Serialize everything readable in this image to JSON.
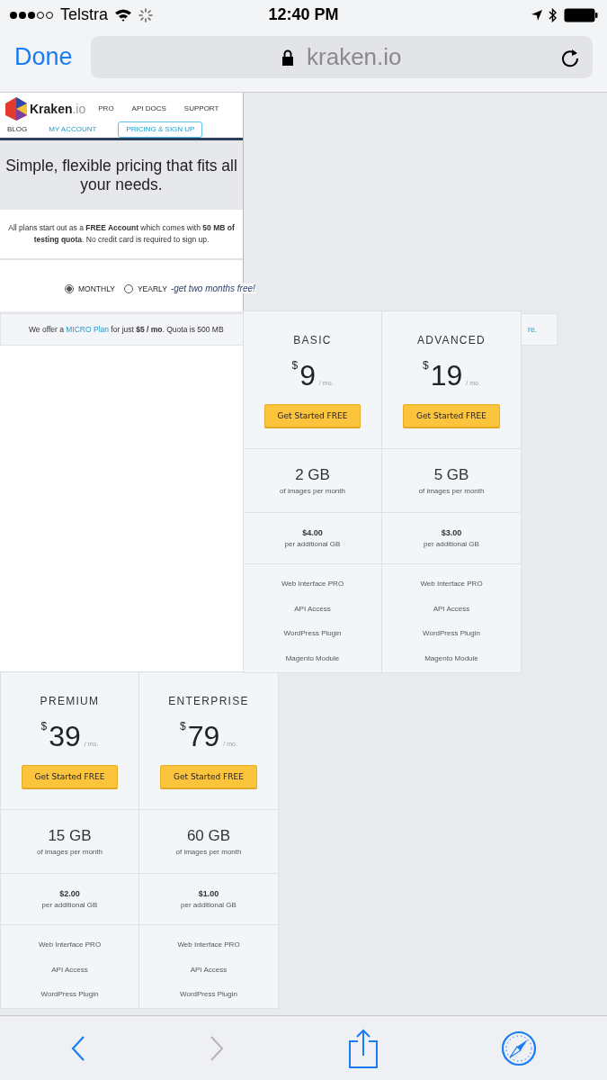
{
  "status_bar": {
    "carrier": "Telstra",
    "time": "12:40 PM"
  },
  "browser": {
    "done": "Done",
    "url": "kraken.io",
    "back_enabled": true,
    "forward_enabled": false
  },
  "nav": {
    "logo": "Kraken",
    "logo_suffix": ".io",
    "items": [
      {
        "label": "PRO",
        "selected": false
      },
      {
        "label": "API DOCS",
        "selected": false
      },
      {
        "label": "SUPPORT",
        "selected": false
      },
      {
        "label": "BLOG",
        "selected": false
      },
      {
        "label": "MY ACCOUNT",
        "selected": false
      },
      {
        "label": "PRICING & SIGN UP",
        "selected": true
      }
    ]
  },
  "headline": "Simple, flexible pricing that fits all your needs.",
  "intro": "All plans start out as a **FREE Account** which comes with **50 MB of testing quota**. No credit card is required to sign up.",
  "billing": [
    {
      "label": "MONTHLY",
      "selected": true
    },
    {
      "label": "YEARLY",
      "selected": false,
      "note": "-get two months free!"
    }
  ],
  "micro_banner": {
    "before": "We offer a ",
    "link": "MICRO Plan",
    "after": " for just **$5 / mo**. Quota is 500 MB",
    "tail_link": "re."
  },
  "plans": [
    {
      "name": "BASIC",
      "currency": "$",
      "price": "9",
      "period": "/ mo.",
      "button": "Get Started FREE",
      "storage": "2 GB",
      "storage_note": "of images per month",
      "extra": "$4.00",
      "extra_note": "per additional GB",
      "features": [
        "Web Interface PRO",
        "API Access",
        "WordPress Plugin",
        "Magento Module"
      ]
    },
    {
      "name": "ADVANCED",
      "currency": "$",
      "price": "19",
      "period": "/ mo.",
      "button": "Get Started FREE",
      "storage": "5 GB",
      "storage_note": "of images per month",
      "extra": "$3.00",
      "extra_note": "per additional GB",
      "features": [
        "Web Interface PRO",
        "API Access",
        "WordPress Plugin",
        "Magento Module"
      ]
    },
    {
      "name": "PREMIUM",
      "currency": "$",
      "price": "39",
      "period": "/ mo.",
      "button": "Get Started FREE",
      "storage": "15 GB",
      "storage_note": "of images per month",
      "extra": "$2.00",
      "extra_note": "per additional GB",
      "features": [
        "Web Interface PRO",
        "API Access",
        "WordPress Plugin"
      ]
    },
    {
      "name": "ENTERPRISE",
      "currency": "$",
      "price": "79",
      "period": "/ mo.",
      "button": "Get Started FREE",
      "storage": "60 GB",
      "storage_note": "of images per month",
      "extra": "$1.00",
      "extra_note": "per additional GB",
      "features": [
        "Web Interface PRO",
        "API Access",
        "WordPress Plugin"
      ]
    }
  ]
}
